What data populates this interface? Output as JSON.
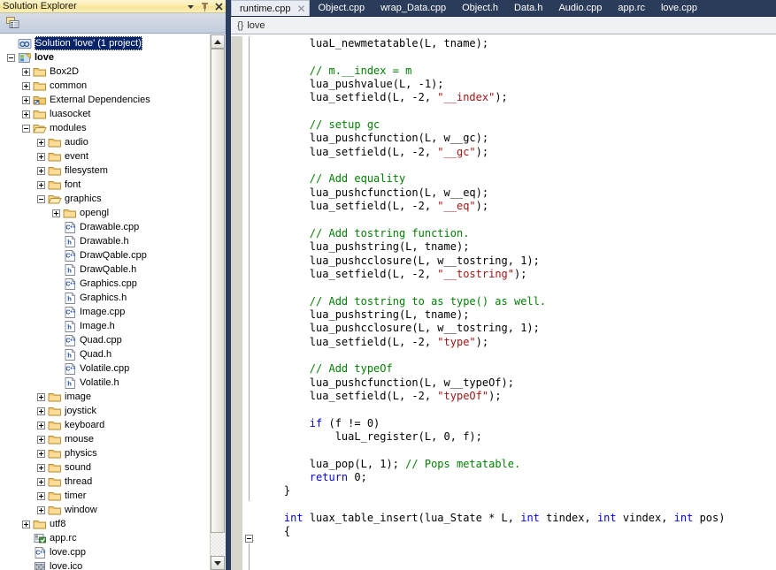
{
  "solution_explorer": {
    "title": "Solution Explorer",
    "title_icons": [
      {
        "name": "dropdown-arrow-icon"
      },
      {
        "name": "pin-icon"
      },
      {
        "name": "close-icon"
      }
    ],
    "toolbar": [
      {
        "name": "properties-icon",
        "label": "Properties"
      }
    ],
    "tree": [
      {
        "label": "Solution 'love' (1 project)",
        "indent": 0,
        "toggle": "none",
        "icon": "solution-icon",
        "selected": true,
        "bold": false
      },
      {
        "label": "love",
        "indent": 0,
        "toggle": "minus",
        "icon": "project-icon",
        "selected": false,
        "bold": true
      },
      {
        "label": "Box2D",
        "indent": 1,
        "toggle": "plus",
        "icon": "folder-icon",
        "selected": false,
        "bold": false
      },
      {
        "label": "common",
        "indent": 1,
        "toggle": "plus",
        "icon": "folder-icon",
        "selected": false,
        "bold": false
      },
      {
        "label": "External Dependencies",
        "indent": 1,
        "toggle": "plus",
        "icon": "extdeps-icon",
        "selected": false,
        "bold": false
      },
      {
        "label": "luasocket",
        "indent": 1,
        "toggle": "plus",
        "icon": "folder-icon",
        "selected": false,
        "bold": false
      },
      {
        "label": "modules",
        "indent": 1,
        "toggle": "minus",
        "icon": "folder-open-icon",
        "selected": false,
        "bold": false
      },
      {
        "label": "audio",
        "indent": 2,
        "toggle": "plus",
        "icon": "folder-icon",
        "selected": false,
        "bold": false
      },
      {
        "label": "event",
        "indent": 2,
        "toggle": "plus",
        "icon": "folder-icon",
        "selected": false,
        "bold": false
      },
      {
        "label": "filesystem",
        "indent": 2,
        "toggle": "plus",
        "icon": "folder-icon",
        "selected": false,
        "bold": false
      },
      {
        "label": "font",
        "indent": 2,
        "toggle": "plus",
        "icon": "folder-icon",
        "selected": false,
        "bold": false
      },
      {
        "label": "graphics",
        "indent": 2,
        "toggle": "minus",
        "icon": "folder-open-icon",
        "selected": false,
        "bold": false
      },
      {
        "label": "opengl",
        "indent": 3,
        "toggle": "plus",
        "icon": "folder-icon",
        "selected": false,
        "bold": false
      },
      {
        "label": "Drawable.cpp",
        "indent": 3,
        "toggle": "none",
        "icon": "cpp-file-icon",
        "selected": false,
        "bold": false
      },
      {
        "label": "Drawable.h",
        "indent": 3,
        "toggle": "none",
        "icon": "h-file-icon",
        "selected": false,
        "bold": false
      },
      {
        "label": "DrawQable.cpp",
        "indent": 3,
        "toggle": "none",
        "icon": "cpp-file-icon",
        "selected": false,
        "bold": false
      },
      {
        "label": "DrawQable.h",
        "indent": 3,
        "toggle": "none",
        "icon": "h-file-icon",
        "selected": false,
        "bold": false
      },
      {
        "label": "Graphics.cpp",
        "indent": 3,
        "toggle": "none",
        "icon": "cpp-file-icon",
        "selected": false,
        "bold": false
      },
      {
        "label": "Graphics.h",
        "indent": 3,
        "toggle": "none",
        "icon": "h-file-icon",
        "selected": false,
        "bold": false
      },
      {
        "label": "Image.cpp",
        "indent": 3,
        "toggle": "none",
        "icon": "cpp-file-icon",
        "selected": false,
        "bold": false
      },
      {
        "label": "Image.h",
        "indent": 3,
        "toggle": "none",
        "icon": "h-file-icon",
        "selected": false,
        "bold": false
      },
      {
        "label": "Quad.cpp",
        "indent": 3,
        "toggle": "none",
        "icon": "cpp-file-icon",
        "selected": false,
        "bold": false
      },
      {
        "label": "Quad.h",
        "indent": 3,
        "toggle": "none",
        "icon": "h-file-icon",
        "selected": false,
        "bold": false
      },
      {
        "label": "Volatile.cpp",
        "indent": 3,
        "toggle": "none",
        "icon": "cpp-file-icon",
        "selected": false,
        "bold": false
      },
      {
        "label": "Volatile.h",
        "indent": 3,
        "toggle": "none",
        "icon": "h-file-icon",
        "selected": false,
        "bold": false
      },
      {
        "label": "image",
        "indent": 2,
        "toggle": "plus",
        "icon": "folder-icon",
        "selected": false,
        "bold": false
      },
      {
        "label": "joystick",
        "indent": 2,
        "toggle": "plus",
        "icon": "folder-icon",
        "selected": false,
        "bold": false
      },
      {
        "label": "keyboard",
        "indent": 2,
        "toggle": "plus",
        "icon": "folder-icon",
        "selected": false,
        "bold": false
      },
      {
        "label": "mouse",
        "indent": 2,
        "toggle": "plus",
        "icon": "folder-icon",
        "selected": false,
        "bold": false
      },
      {
        "label": "physics",
        "indent": 2,
        "toggle": "plus",
        "icon": "folder-icon",
        "selected": false,
        "bold": false
      },
      {
        "label": "sound",
        "indent": 2,
        "toggle": "plus",
        "icon": "folder-icon",
        "selected": false,
        "bold": false
      },
      {
        "label": "thread",
        "indent": 2,
        "toggle": "plus",
        "icon": "folder-icon",
        "selected": false,
        "bold": false
      },
      {
        "label": "timer",
        "indent": 2,
        "toggle": "plus",
        "icon": "folder-icon",
        "selected": false,
        "bold": false
      },
      {
        "label": "window",
        "indent": 2,
        "toggle": "plus",
        "icon": "folder-icon",
        "selected": false,
        "bold": false
      },
      {
        "label": "utf8",
        "indent": 1,
        "toggle": "plus",
        "icon": "folder-icon",
        "selected": false,
        "bold": false
      },
      {
        "label": "app.rc",
        "indent": 1,
        "toggle": "none",
        "icon": "rc-file-icon",
        "selected": false,
        "bold": false
      },
      {
        "label": "love.cpp",
        "indent": 1,
        "toggle": "none",
        "icon": "cpp-file-icon",
        "selected": false,
        "bold": false
      },
      {
        "label": "love.ico",
        "indent": 1,
        "toggle": "none",
        "icon": "ico-file-icon",
        "selected": false,
        "bold": false
      }
    ],
    "scrollbar": {
      "up_arrow": "scroll-up-icon",
      "down_arrow": "scroll-down-icon"
    }
  },
  "editor": {
    "tabs": [
      {
        "label": "runtime.cpp",
        "active": true,
        "close_icon": "close-icon"
      },
      {
        "label": "Object.cpp",
        "active": false
      },
      {
        "label": "wrap_Data.cpp",
        "active": false
      },
      {
        "label": "Object.h",
        "active": false
      },
      {
        "label": "Data.h",
        "active": false
      },
      {
        "label": "Audio.cpp",
        "active": false
      },
      {
        "label": "app.rc",
        "active": false
      },
      {
        "label": "love.cpp",
        "active": false
      }
    ],
    "navbar": {
      "brace": "{}",
      "scope": "love"
    },
    "code_lines": [
      [
        {
          "t": "        luaL_newmetatable(L, tname);",
          "c": "id"
        }
      ],
      [],
      [
        {
          "t": "        ",
          "c": "id"
        },
        {
          "t": "// m.__index = m",
          "c": "com"
        }
      ],
      [
        {
          "t": "        lua_pushvalue(L, -1);",
          "c": "id"
        }
      ],
      [
        {
          "t": "        lua_setfield(L, -2, ",
          "c": "id"
        },
        {
          "t": "\"__index\"",
          "c": "str"
        },
        {
          "t": ");",
          "c": "id"
        }
      ],
      [],
      [
        {
          "t": "        ",
          "c": "id"
        },
        {
          "t": "// setup gc",
          "c": "com"
        }
      ],
      [
        {
          "t": "        lua_pushcfunction(L, w__gc);",
          "c": "id"
        }
      ],
      [
        {
          "t": "        lua_setfield(L, -2, ",
          "c": "id"
        },
        {
          "t": "\"__gc\"",
          "c": "str"
        },
        {
          "t": ");",
          "c": "id"
        }
      ],
      [],
      [
        {
          "t": "        ",
          "c": "id"
        },
        {
          "t": "// Add equality",
          "c": "com"
        }
      ],
      [
        {
          "t": "        lua_pushcfunction(L, w__eq);",
          "c": "id"
        }
      ],
      [
        {
          "t": "        lua_setfield(L, -2, ",
          "c": "id"
        },
        {
          "t": "\"__eq\"",
          "c": "str"
        },
        {
          "t": ");",
          "c": "id"
        }
      ],
      [],
      [
        {
          "t": "        ",
          "c": "id"
        },
        {
          "t": "// Add tostring function.",
          "c": "com"
        }
      ],
      [
        {
          "t": "        lua_pushstring(L, tname);",
          "c": "id"
        }
      ],
      [
        {
          "t": "        lua_pushcclosure(L, w__tostring, 1);",
          "c": "id"
        }
      ],
      [
        {
          "t": "        lua_setfield(L, -2, ",
          "c": "id"
        },
        {
          "t": "\"__tostring\"",
          "c": "str"
        },
        {
          "t": ");",
          "c": "id"
        }
      ],
      [],
      [
        {
          "t": "        ",
          "c": "id"
        },
        {
          "t": "// Add tostring to as type() as well.",
          "c": "com"
        }
      ],
      [
        {
          "t": "        lua_pushstring(L, tname);",
          "c": "id"
        }
      ],
      [
        {
          "t": "        lua_pushcclosure(L, w__tostring, 1);",
          "c": "id"
        }
      ],
      [
        {
          "t": "        lua_setfield(L, -2, ",
          "c": "id"
        },
        {
          "t": "\"type\"",
          "c": "str"
        },
        {
          "t": ");",
          "c": "id"
        }
      ],
      [],
      [
        {
          "t": "        ",
          "c": "id"
        },
        {
          "t": "// Add typeOf",
          "c": "com"
        }
      ],
      [
        {
          "t": "        lua_pushcfunction(L, w__typeOf);",
          "c": "id"
        }
      ],
      [
        {
          "t": "        lua_setfield(L, -2, ",
          "c": "id"
        },
        {
          "t": "\"typeOf\"",
          "c": "str"
        },
        {
          "t": ");",
          "c": "id"
        }
      ],
      [],
      [
        {
          "t": "        ",
          "c": "id"
        },
        {
          "t": "if",
          "c": "kw"
        },
        {
          "t": " (f != 0)",
          "c": "id"
        }
      ],
      [
        {
          "t": "            luaL_register(L, 0, f);",
          "c": "id"
        }
      ],
      [],
      [
        {
          "t": "        lua_pop(L, 1); ",
          "c": "id"
        },
        {
          "t": "// Pops metatable.",
          "c": "com"
        }
      ],
      [
        {
          "t": "        ",
          "c": "id"
        },
        {
          "t": "return",
          "c": "kw"
        },
        {
          "t": " 0;",
          "c": "id"
        }
      ],
      [
        {
          "t": "    }",
          "c": "id"
        }
      ],
      [],
      [
        {
          "t": "    ",
          "c": "id"
        },
        {
          "t": "int",
          "c": "kw"
        },
        {
          "t": " luax_table_insert(lua_State * L, ",
          "c": "id"
        },
        {
          "t": "int",
          "c": "kw"
        },
        {
          "t": " tindex, ",
          "c": "id"
        },
        {
          "t": "int",
          "c": "kw"
        },
        {
          "t": " vindex, ",
          "c": "id"
        },
        {
          "t": "int",
          "c": "kw"
        },
        {
          "t": " pos)",
          "c": "id"
        }
      ],
      [
        {
          "t": "    {",
          "c": "id"
        }
      ]
    ]
  },
  "colors": {
    "titlebar_gold": "#f7e393",
    "tabstrip_navy": "#2b3c5a",
    "active_tab_bg": "#e9ecf2",
    "selection_blue": "#0a246a",
    "comment_green": "#008000",
    "string_red": "#a31515",
    "keyword_blue": "#0000ff",
    "folder_yellow": "#f5c96b"
  }
}
